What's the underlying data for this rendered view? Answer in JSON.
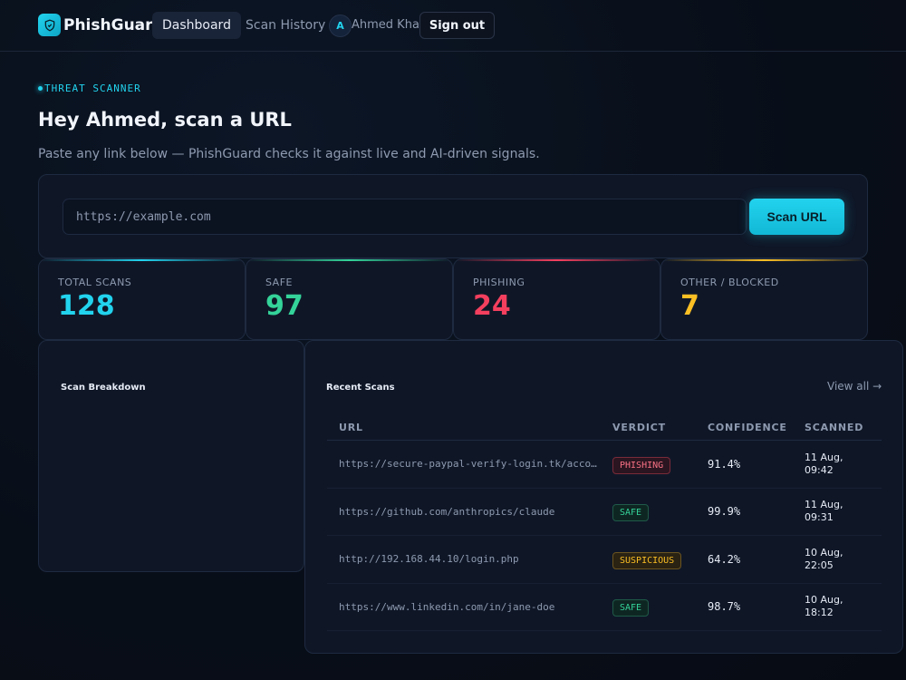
{
  "app": {
    "name": "PhishGuard"
  },
  "nav": {
    "dashboard": "Dashboard",
    "history": "Scan History"
  },
  "user": {
    "initial": "A",
    "name": "Ahmed Khan",
    "signout": "Sign out"
  },
  "hero": {
    "eyebrow": "THREAT SCANNER",
    "greeting": "Hey Ahmed, scan a URL",
    "subtitle": "Paste any link below — PhishGuard checks it against live and AI-driven signals."
  },
  "scan": {
    "placeholder": "https://example.com",
    "value": "",
    "button": "Scan URL"
  },
  "stats": [
    {
      "label": "TOTAL SCANS",
      "value": "128",
      "color": "#22d3ee"
    },
    {
      "label": "SAFE",
      "value": "97",
      "color": "#34d399"
    },
    {
      "label": "PHISHING",
      "value": "24",
      "color": "#f43f5e"
    },
    {
      "label": "OTHER / BLOCKED",
      "value": "7",
      "color": "#fbbf24"
    }
  ],
  "breakdown": {
    "title": "Scan Breakdown"
  },
  "recent": {
    "title": "Recent Scans",
    "view_all": "View all →",
    "columns": [
      "URL",
      "VERDICT",
      "CONFIDENCE",
      "SCANNED"
    ],
    "rows": [
      {
        "url": "https://secure-paypal-verify-login.tk/account",
        "verdict": "PHISHING",
        "confidence": "91.4%",
        "date": "11 Aug,",
        "time": "09:42"
      },
      {
        "url": "https://github.com/anthropics/claude",
        "verdict": "SAFE",
        "confidence": "99.9%",
        "date": "11 Aug,",
        "time": "09:31"
      },
      {
        "url": "http://192.168.44.10/login.php",
        "verdict": "SUSPICIOUS",
        "confidence": "64.2%",
        "date": "10 Aug,",
        "time": "22:05"
      },
      {
        "url": "https://www.linkedin.com/in/jane-doe",
        "verdict": "SAFE",
        "confidence": "98.7%",
        "date": "10 Aug,",
        "time": "18:12"
      }
    ]
  },
  "verdict_colors": {
    "PHISHING": {
      "fg": "#f87185",
      "bg": "#2a1520",
      "border": "#7a2a3a"
    },
    "SAFE": {
      "fg": "#34d399",
      "bg": "#0e2622",
      "border": "#1f5a48"
    },
    "SUSPICIOUS": {
      "fg": "#fbbf24",
      "bg": "#2a2212",
      "border": "#6b5420"
    }
  }
}
